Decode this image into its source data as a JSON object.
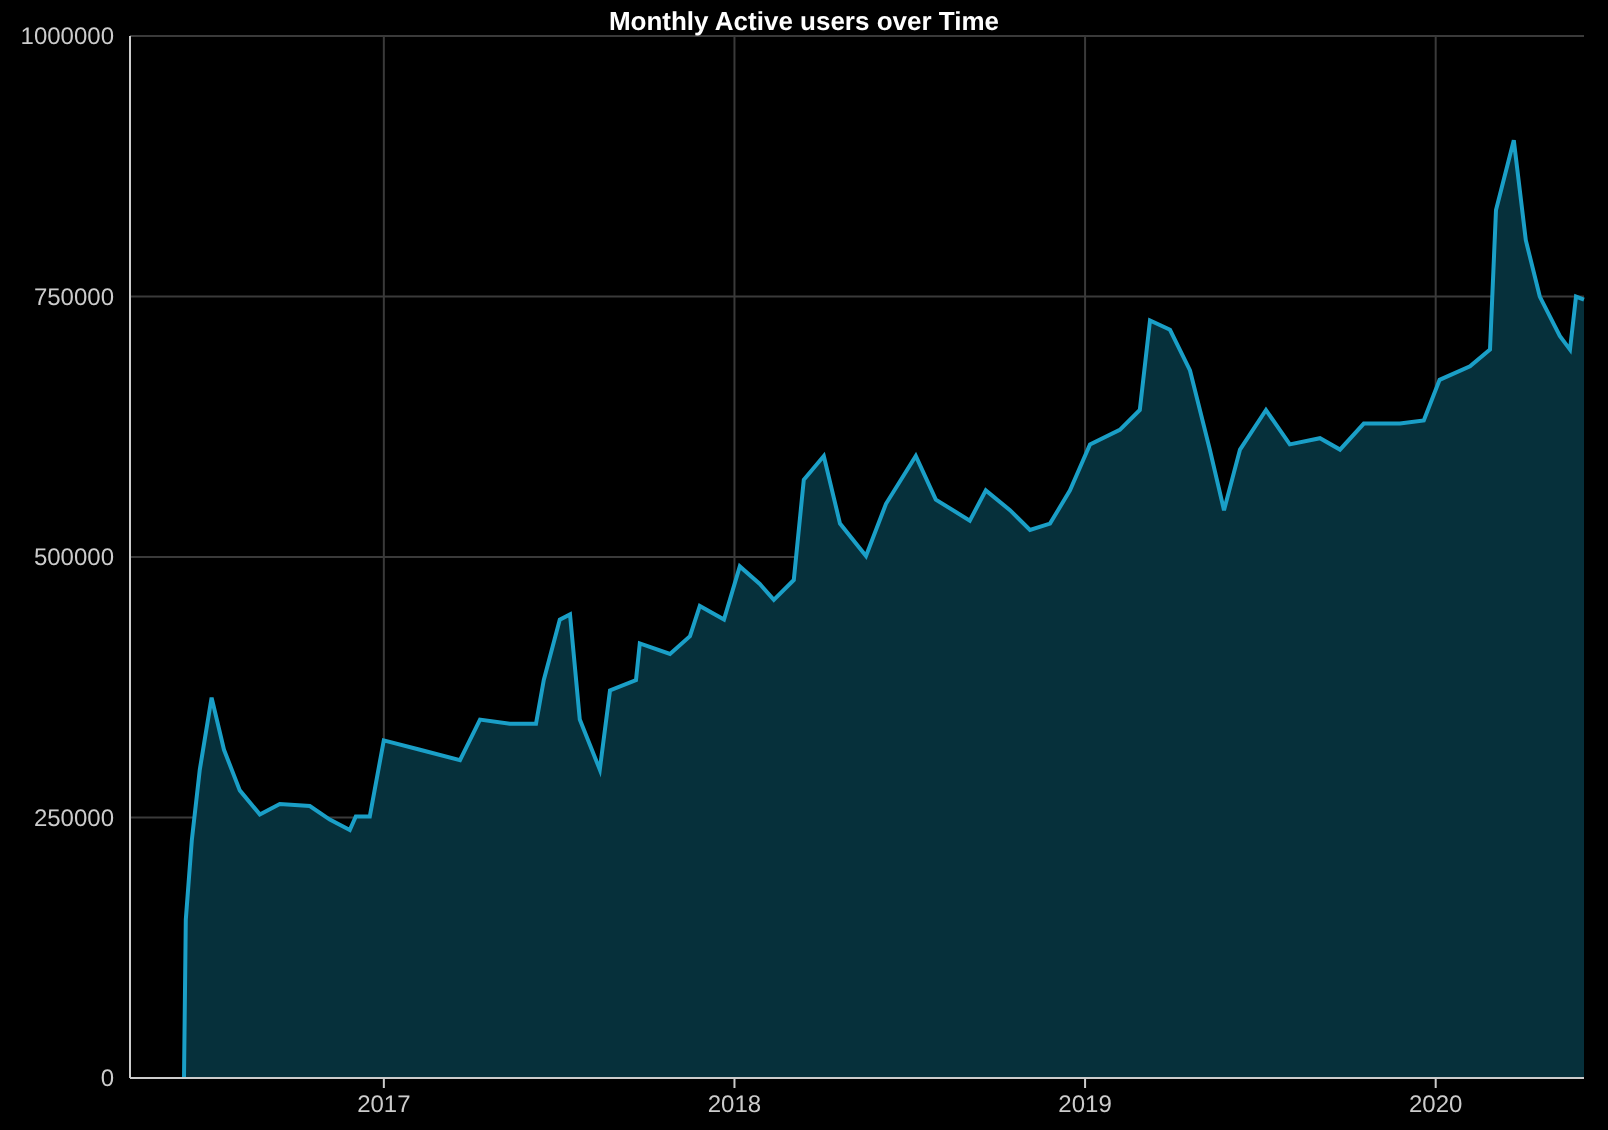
{
  "chart": {
    "chart_data": {
      "type": "area",
      "title": "Monthly Active users over Time",
      "grid": true,
      "x": [
        2016.43,
        2016.435,
        2016.452,
        2016.475,
        2016.509,
        2016.544,
        2016.589,
        2016.646,
        2016.703,
        2016.789,
        2016.846,
        2016.903,
        2016.92,
        2016.96,
        2017.0,
        2017.103,
        2017.217,
        2017.274,
        2017.359,
        2017.434,
        2017.456,
        2017.502,
        2017.531,
        2017.559,
        2017.616,
        2017.645,
        2017.719,
        2017.73,
        2017.816,
        2017.873,
        2017.901,
        2017.97,
        2018.015,
        2018.072,
        2018.112,
        2018.169,
        2018.198,
        2018.255,
        2018.301,
        2018.375,
        2018.432,
        2018.517,
        2018.574,
        2018.671,
        2018.717,
        2018.786,
        2018.843,
        2018.9,
        2018.957,
        2019.014,
        2019.099,
        2019.156,
        2019.185,
        2019.242,
        2019.299,
        2019.356,
        2019.396,
        2019.442,
        2019.516,
        2019.584,
        2019.67,
        2019.727,
        2019.795,
        2019.898,
        2019.966,
        2020.011,
        2020.098,
        2020.155,
        2020.172,
        2020.223,
        2020.257,
        2020.297,
        2020.354,
        2020.383,
        2020.4,
        2020.423
      ],
      "series": [
        {
          "color": "#1a9fc7",
          "values": [
            0,
            152000,
            228000,
            296000,
            365000,
            315000,
            276000,
            253000,
            263000,
            261000,
            248000,
            238000,
            251000,
            251000,
            324000,
            315000,
            305000,
            344000,
            340000,
            340000,
            382000,
            440000,
            445000,
            344000,
            296000,
            372000,
            382000,
            417000,
            407000,
            424000,
            453000,
            440000,
            491000,
            474000,
            459000,
            478000,
            574000,
            597000,
            532000,
            501000,
            551000,
            597000,
            555000,
            535000,
            564000,
            545000,
            526000,
            532000,
            564000,
            608000,
            622000,
            641000,
            727000,
            718000,
            679000,
            603000,
            545000,
            603000,
            641000,
            608000,
            614000,
            603000,
            628000,
            628000,
            631000,
            670000,
            683000,
            699000,
            833000,
            900000,
            804000,
            750000,
            712000,
            699000,
            750000,
            747000
          ]
        }
      ],
      "xlim": [
        2016.276,
        2020.423
      ],
      "ylim": [
        0,
        1000000
      ],
      "xticks": [
        2017,
        2018,
        2019,
        2020
      ],
      "yticks": [
        {
          "value": 0,
          "label": "0"
        },
        {
          "value": 250000,
          "label": "250000"
        },
        {
          "value": 500000,
          "label": "500000"
        },
        {
          "value": 750000,
          "label": "750000"
        },
        {
          "value": 1000000,
          "label": "1000000"
        }
      ]
    }
  }
}
